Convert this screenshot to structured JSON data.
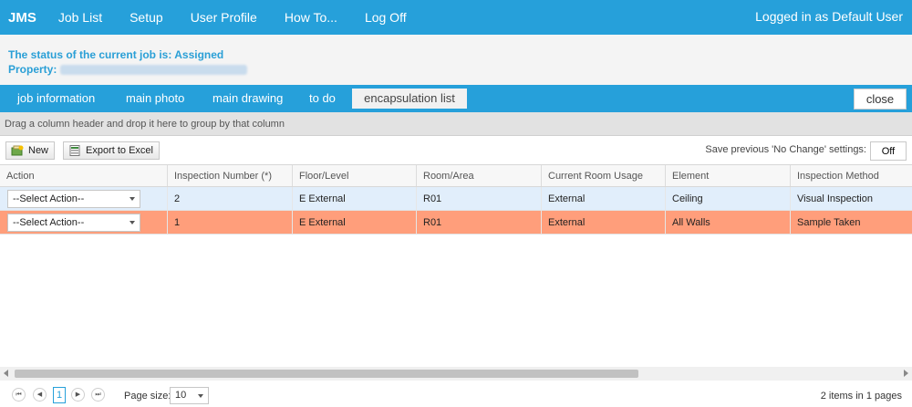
{
  "app": {
    "brand": "JMS",
    "user_text": "Logged in as Default User"
  },
  "nav": [
    {
      "label": "Job List"
    },
    {
      "label": "Setup"
    },
    {
      "label": "User Profile"
    },
    {
      "label": "How To..."
    },
    {
      "label": "Log Off"
    }
  ],
  "status": {
    "job_status": "The status of the current job is: Assigned",
    "property_label": "Property:"
  },
  "tabs": [
    {
      "label": "job information"
    },
    {
      "label": "main photo"
    },
    {
      "label": "main drawing"
    },
    {
      "label": "to do"
    },
    {
      "label": "encapsulation list"
    }
  ],
  "close_label": "close",
  "group_hint": "Drag a column header and drop it here to group by that column",
  "toolbar": {
    "new_label": "New",
    "export_label": "Export to Excel",
    "save_label": "Save previous 'No Change' settings:",
    "off_label": "Off"
  },
  "columns": [
    "Action",
    "Inspection Number (*)",
    "Floor/Level",
    "Room/Area",
    "Current Room Usage",
    "Element",
    "Inspection Method"
  ],
  "rows": [
    {
      "action": "--Select Action--",
      "inspection": "2",
      "floor": "E External",
      "room": "R01",
      "usage": "External",
      "element": "Ceiling",
      "method": "Visual Inspection"
    },
    {
      "action": "--Select Action--",
      "inspection": "1",
      "floor": "E External",
      "room": "R01",
      "usage": "External",
      "element": "All Walls",
      "method": "Sample Taken"
    }
  ],
  "pager": {
    "current_page": "1",
    "page_size_label": "Page size:",
    "page_size": "10",
    "info": "2 items in 1 pages"
  },
  "colors": {
    "accent": "#26a0da",
    "highlight_row": "#ff9e7b",
    "selected_row": "#e1eefb"
  }
}
